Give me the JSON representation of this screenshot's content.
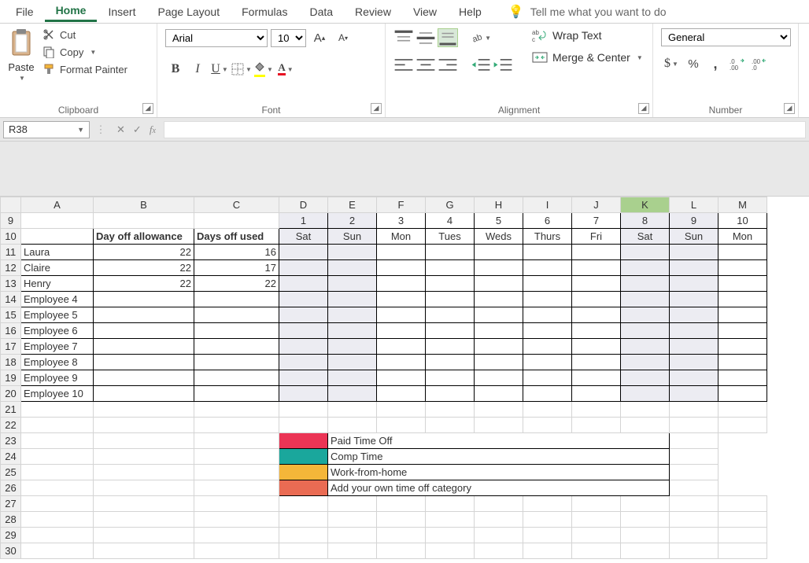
{
  "menu": {
    "items": [
      "File",
      "Home",
      "Insert",
      "Page Layout",
      "Formulas",
      "Data",
      "Review",
      "View",
      "Help"
    ],
    "active": "Home",
    "tell_me": "Tell me what you want to do"
  },
  "ribbon": {
    "clipboard": {
      "paste": "Paste",
      "cut": "Cut",
      "copy": "Copy",
      "format_painter": "Format Painter",
      "group_label": "Clipboard"
    },
    "font": {
      "name": "Arial",
      "size": "10",
      "group_label": "Font"
    },
    "alignment": {
      "wrap": "Wrap Text",
      "merge": "Merge & Center",
      "group_label": "Alignment"
    },
    "number": {
      "format": "General",
      "group_label": "Number"
    }
  },
  "formula_bar": {
    "name_box": "R38"
  },
  "columns": [
    "A",
    "B",
    "C",
    "D",
    "E",
    "F",
    "G",
    "H",
    "I",
    "J",
    "K",
    "L",
    "M"
  ],
  "selected_col": "K",
  "row_headers": [
    "9",
    "10",
    "11",
    "12",
    "13",
    "14",
    "15",
    "16",
    "17",
    "18",
    "19",
    "20",
    "21",
    "22",
    "23",
    "24",
    "25",
    "26",
    "27",
    "28",
    "29",
    "30"
  ],
  "header_row_dates": [
    "",
    "",
    "",
    "1",
    "2",
    "3",
    "4",
    "5",
    "6",
    "7",
    "8",
    "9",
    "10"
  ],
  "header_row_days_B": "Day off allowance",
  "header_row_days_C": "Days off used",
  "header_row_days": [
    "Sat",
    "Sun",
    "Mon",
    "Tues",
    "Weds",
    "Thurs",
    "Fri",
    "Sat",
    "Sun",
    "Mon"
  ],
  "weekend_cols": [
    3,
    4,
    10,
    11
  ],
  "employees": [
    {
      "name": "Laura",
      "allowance": "22",
      "used": "16"
    },
    {
      "name": "Claire",
      "allowance": "22",
      "used": "17"
    },
    {
      "name": "Henry",
      "allowance": "22",
      "used": "22"
    },
    {
      "name": "Employee 4",
      "allowance": "",
      "used": ""
    },
    {
      "name": "Employee 5",
      "allowance": "",
      "used": ""
    },
    {
      "name": "Employee 6",
      "allowance": "",
      "used": ""
    },
    {
      "name": "Employee 7",
      "allowance": "",
      "used": ""
    },
    {
      "name": "Employee 8",
      "allowance": "",
      "used": ""
    },
    {
      "name": "Employee 9",
      "allowance": "",
      "used": ""
    },
    {
      "name": "Employee 10",
      "allowance": "",
      "used": ""
    }
  ],
  "legend": [
    {
      "color": "legend-pink",
      "label": "Paid Time Off"
    },
    {
      "color": "legend-teal",
      "label": "Comp Time"
    },
    {
      "color": "legend-orange",
      "label": "Work-from-home"
    },
    {
      "color": "legend-salmon",
      "label": "Add your own time off category"
    }
  ]
}
